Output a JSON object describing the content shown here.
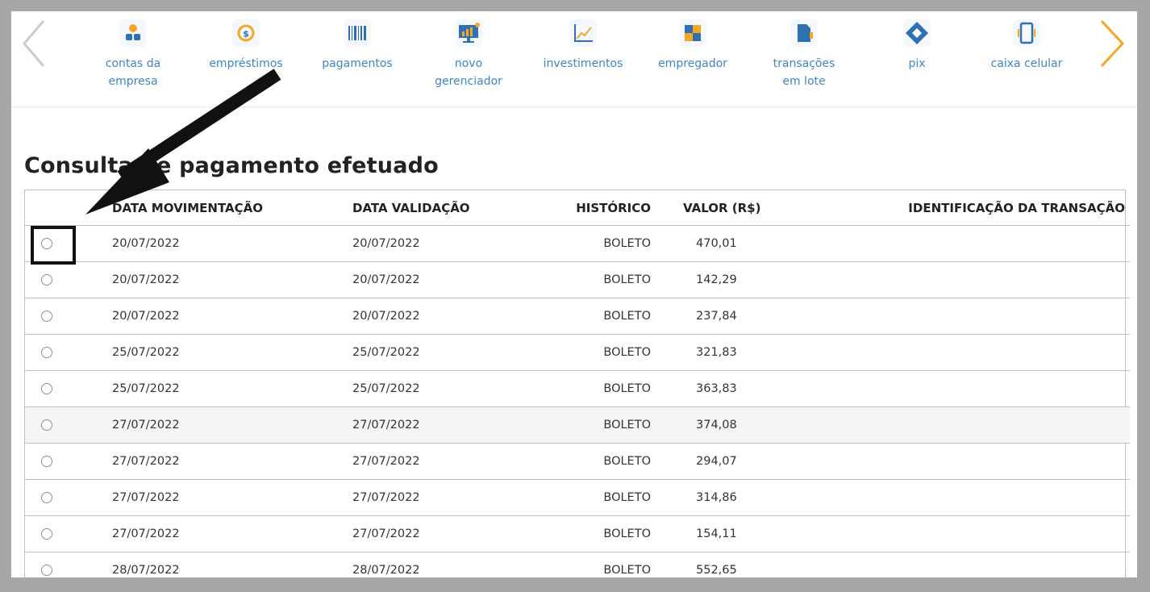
{
  "nav": {
    "prev_arrow": "chevron-left-icon",
    "next_arrow": "chevron-right-icon",
    "items": [
      {
        "label": "contas da empresa",
        "icon": "people-icon"
      },
      {
        "label": "empréstimos",
        "icon": "coin-icon"
      },
      {
        "label": "pagamentos",
        "icon": "barcode-icon"
      },
      {
        "label": "novo gerenciador",
        "icon": "monitor-chart-icon"
      },
      {
        "label": "investimentos",
        "icon": "line-chart-icon"
      },
      {
        "label": "empregador",
        "icon": "puzzle-icon"
      },
      {
        "label": "transações em lote",
        "icon": "document-stack-icon"
      },
      {
        "label": "pix",
        "icon": "pix-icon"
      },
      {
        "label": "caixa celular",
        "icon": "phone-icon"
      }
    ]
  },
  "page": {
    "title": "Consulta de pagamento efetuado"
  },
  "table": {
    "headers": {
      "data_movimentacao": "DATA MOVIMENTAÇÃO",
      "data_validacao": "DATA VALIDAÇÃO",
      "historico": "HISTÓRICO",
      "valor": "VALOR (R$)",
      "identificacao": "IDENTIFICAÇÃO DA TRANSAÇÃO"
    },
    "rows": [
      {
        "data_movimentacao": "20/07/2022",
        "data_validacao": "20/07/2022",
        "historico": "BOLETO",
        "valor": "470,01",
        "identificacao": ""
      },
      {
        "data_movimentacao": "20/07/2022",
        "data_validacao": "20/07/2022",
        "historico": "BOLETO",
        "valor": "142,29",
        "identificacao": ""
      },
      {
        "data_movimentacao": "20/07/2022",
        "data_validacao": "20/07/2022",
        "historico": "BOLETO",
        "valor": "237,84",
        "identificacao": ""
      },
      {
        "data_movimentacao": "25/07/2022",
        "data_validacao": "25/07/2022",
        "historico": "BOLETO",
        "valor": "321,83",
        "identificacao": ""
      },
      {
        "data_movimentacao": "25/07/2022",
        "data_validacao": "25/07/2022",
        "historico": "BOLETO",
        "valor": "363,83",
        "identificacao": ""
      },
      {
        "data_movimentacao": "27/07/2022",
        "data_validacao": "27/07/2022",
        "historico": "BOLETO",
        "valor": "374,08",
        "identificacao": ""
      },
      {
        "data_movimentacao": "27/07/2022",
        "data_validacao": "27/07/2022",
        "historico": "BOLETO",
        "valor": "294,07",
        "identificacao": ""
      },
      {
        "data_movimentacao": "27/07/2022",
        "data_validacao": "27/07/2022",
        "historico": "BOLETO",
        "valor": "314,86",
        "identificacao": ""
      },
      {
        "data_movimentacao": "27/07/2022",
        "data_validacao": "27/07/2022",
        "historico": "BOLETO",
        "valor": "154,11",
        "identificacao": ""
      },
      {
        "data_movimentacao": "28/07/2022",
        "data_validacao": "28/07/2022",
        "historico": "BOLETO",
        "valor": "552,65",
        "identificacao": ""
      }
    ]
  },
  "colors": {
    "accent_blue": "#3f86c6",
    "accent_orange": "#f5a623",
    "arrow_inactive": "#cccccc",
    "annotation": "#111111"
  }
}
